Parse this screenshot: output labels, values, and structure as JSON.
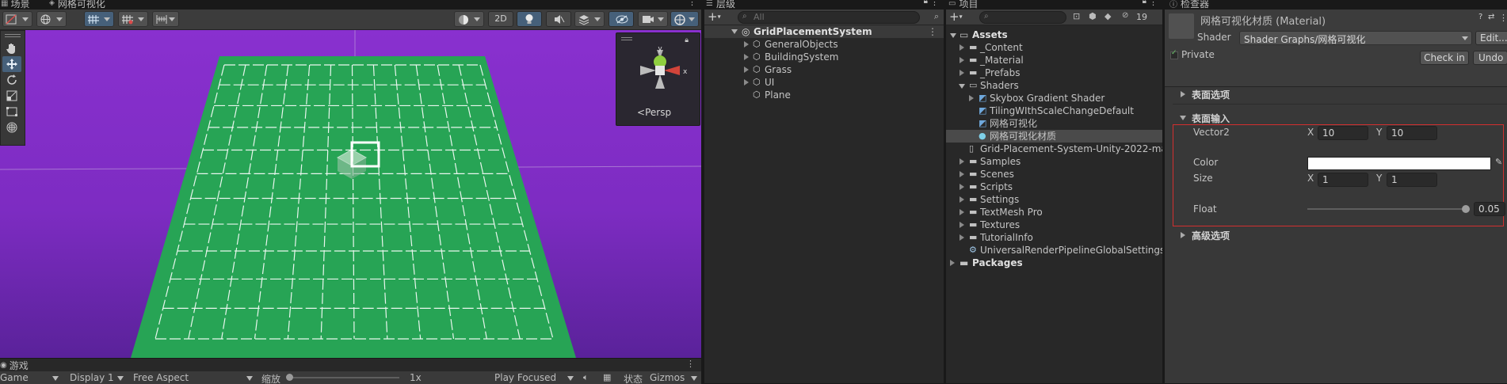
{
  "scene": {
    "tab_label": "场景",
    "tab2_label": "网格可视化",
    "btn_2d": "2D",
    "gizmo_label": "Persp"
  },
  "game": {
    "tab_label": "游戏",
    "view_select": "Game",
    "display_select": "Display 1",
    "aspect_select": "Free Aspect",
    "scale_label": "缩放",
    "scale_value": "1x",
    "play_select": "Play Focused",
    "stats_label": "状态",
    "gizmos_label": "Gizmos"
  },
  "hierarchy": {
    "tab_label": "层级",
    "search_placeholder": "All",
    "root": "GridPlacementSystem",
    "items": [
      "GeneralObjects",
      "BuildingSystem",
      "Grass",
      "UI",
      "Plane"
    ]
  },
  "project": {
    "tab_label": "项目",
    "hidden_count": "19",
    "assets_label": "Assets",
    "items": [
      {
        "label": "_Content"
      },
      {
        "label": "_Material"
      },
      {
        "label": "_Prefabs"
      },
      {
        "label": "Shaders"
      },
      {
        "label": "Skybox Gradient Shader"
      },
      {
        "label": "TilingWIthScaleChangeDefault"
      },
      {
        "label": "网格可视化"
      },
      {
        "label": "网格可视化材质"
      },
      {
        "label": "Grid-Placement-System-Unity-2022-ma"
      },
      {
        "label": "Samples"
      },
      {
        "label": "Scenes"
      },
      {
        "label": "Scripts"
      },
      {
        "label": "Settings"
      },
      {
        "label": "TextMesh Pro"
      },
      {
        "label": "Textures"
      },
      {
        "label": "TutorialInfo"
      },
      {
        "label": "UniversalRenderPipelineGlobalSettings"
      }
    ],
    "packages_label": "Packages"
  },
  "inspector": {
    "tab_label": "检查器",
    "material_title": "网格可视化材质 (Material)",
    "shader_label": "Shader",
    "shader_value": "Shader Graphs/网格可视化",
    "edit_label": "Edit...",
    "private_label": "Private",
    "checkin_label": "Check in",
    "undo_label": "Undo",
    "surface_options": "表面选项",
    "surface_inputs": "表面输入",
    "vector2_label": "Vector2",
    "x_label": "X",
    "y_label": "Y",
    "vector2_x": "10",
    "vector2_y": "10",
    "color_label": "Color",
    "color_value": "#ffffff",
    "size_label": "Size",
    "size_x": "1",
    "size_y": "1",
    "float_label": "Float",
    "float_value": "0.05",
    "float_fraction": 1.0,
    "advanced_options": "高级选项"
  },
  "colors": {
    "accent": "#3a72b0",
    "selection": "#2c5d87",
    "highlight_border": "#d32f2f",
    "plane_green": "#27a455",
    "sky_purple": "#8b2fd0"
  }
}
